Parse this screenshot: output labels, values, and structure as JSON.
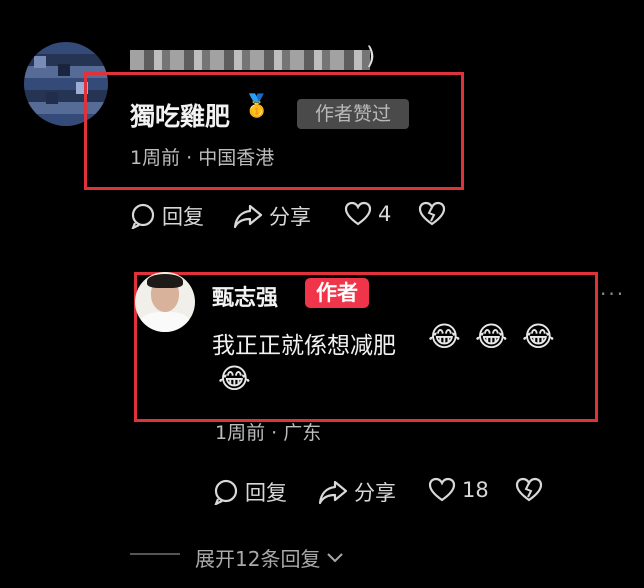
{
  "comment": {
    "username_hidden": true,
    "paren": ")",
    "name": "獨吃雞肥",
    "medal_emoji": "🥇",
    "liked_badge": "作者赞过",
    "meta": "1周前 · 中国香港",
    "actions": {
      "reply": "回复",
      "share": "分享",
      "likes": "4"
    }
  },
  "reply": {
    "name": "甄志强",
    "author_badge": "作者",
    "text": "我正正就係想减肥",
    "emojis_line1": [
      "😂",
      "😂",
      "😂"
    ],
    "emojis_line2": [
      "😂"
    ],
    "meta": "1周前 · 广东",
    "actions": {
      "reply": "回复",
      "share": "分享",
      "likes": "18"
    },
    "more": "···"
  },
  "expand": {
    "label": "展开12条回复"
  },
  "colors": {
    "highlight_box": "#e0323a",
    "author_badge": "#f0354a",
    "background": "#000000"
  }
}
